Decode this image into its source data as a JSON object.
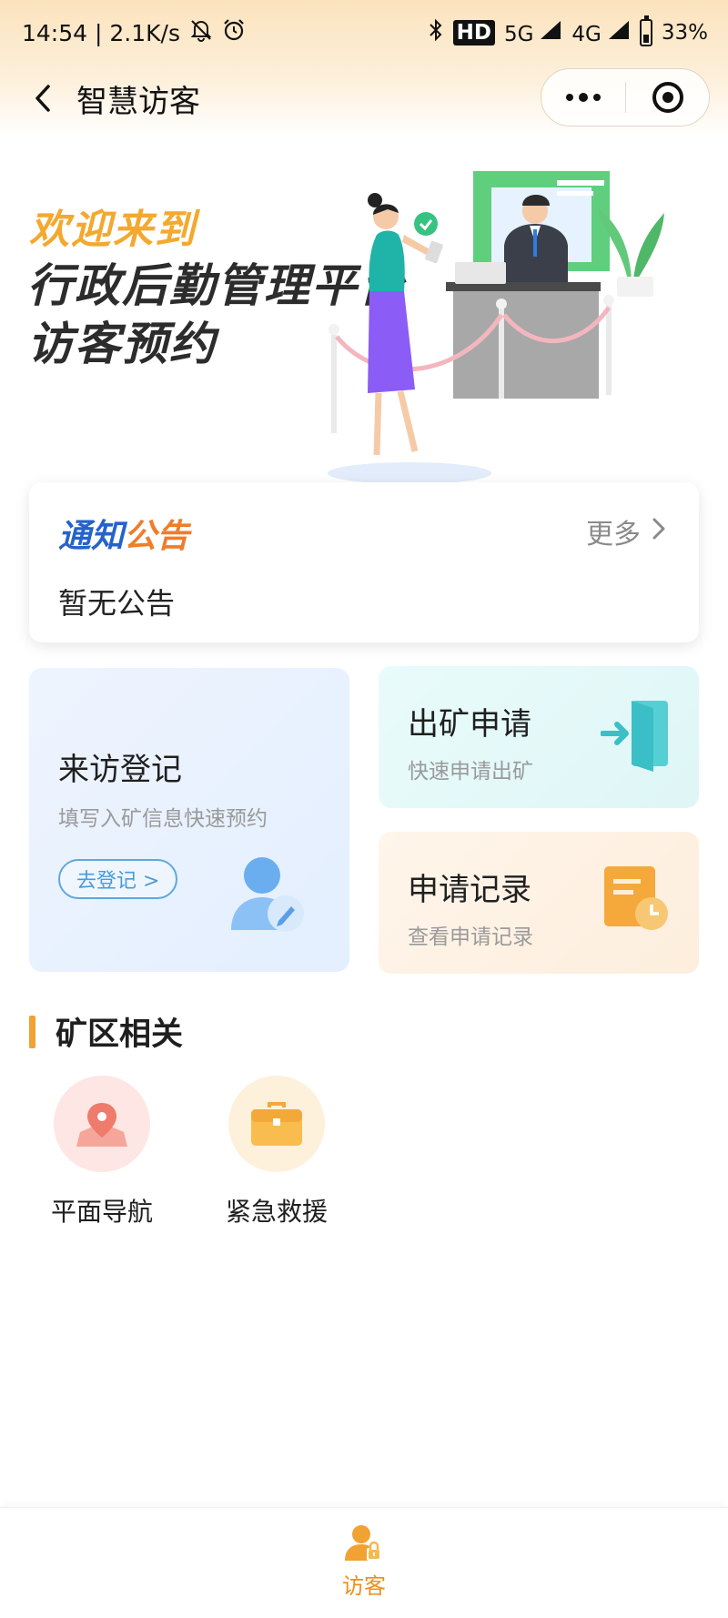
{
  "status_bar": {
    "time_speed": "14:54 | 2.1K/s",
    "hd": "HD",
    "sig1": "5G",
    "sig2": "4G",
    "battery": "33%"
  },
  "nav": {
    "title": "智慧访客"
  },
  "banner": {
    "welcome": "欢迎来到",
    "title_line1": "行政后勤管理平台",
    "title_line2": "访客预约"
  },
  "notice": {
    "title_part1": "通知",
    "title_part2": "公告",
    "more_label": "更多",
    "empty_text": "暂无公告"
  },
  "tiles": {
    "visit": {
      "title": "来访登记",
      "subtitle": "填写入矿信息快速预约",
      "button": "去登记 >"
    },
    "exit": {
      "title": "出矿申请",
      "subtitle": "快速申请出矿"
    },
    "record": {
      "title": "申请记录",
      "subtitle": "查看申请记录"
    }
  },
  "section": {
    "title": "矿区相关",
    "items": [
      {
        "label": "平面导航",
        "icon": "map-pin-icon"
      },
      {
        "label": "紧急救援",
        "icon": "briefcase-icon"
      }
    ]
  },
  "tab_bar": {
    "items": [
      {
        "label": "访客",
        "icon": "visitor-icon",
        "active": true
      }
    ]
  },
  "colors": {
    "accent_orange": "#f0a233",
    "notice_blue": "#2563c9",
    "notice_orange": "#ef7d2a",
    "button_blue": "#4a9bd8",
    "tab_active": "#ef8f1c"
  }
}
